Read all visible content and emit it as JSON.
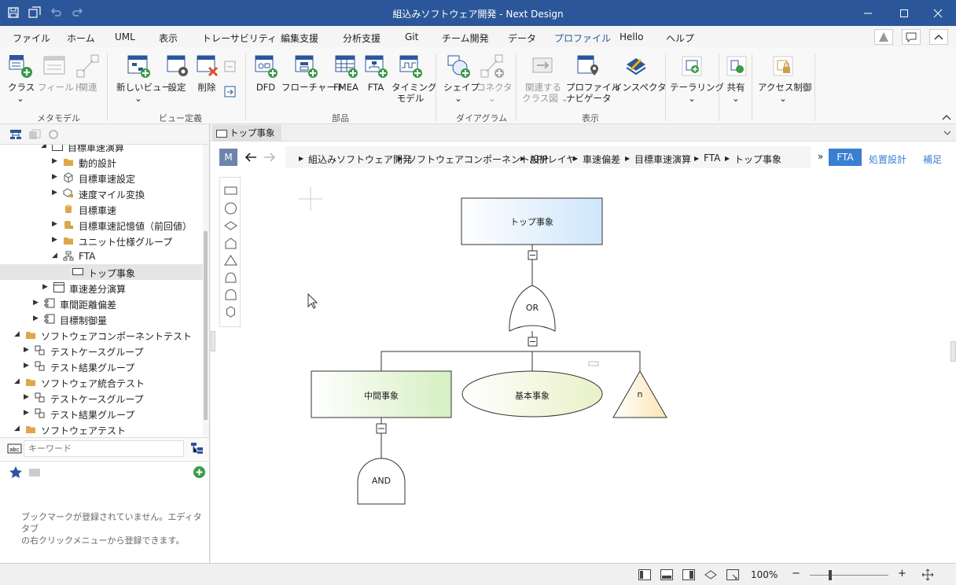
{
  "window": {
    "title": "組込みソフトウェア開発 - Next Design"
  },
  "menu": [
    "ファイル",
    "ホーム",
    "UML",
    "表示",
    "トレーサビリティ",
    "編集支援",
    "分析支援",
    "Git",
    "チーム開発",
    "データ",
    "プロファイル",
    "Hello",
    "ヘルプ"
  ],
  "ribbon": {
    "metamodel": {
      "group": "メタモデル",
      "class": "クラス",
      "field": "フィールド",
      "relation": "関連"
    },
    "viewdef": {
      "group": "ビュー定義",
      "new_view": "新しいビュー",
      "settings": "設定",
      "delete": "削除"
    },
    "parts": {
      "group": "部品",
      "dfd": "DFD",
      "flowchart": "フローチャート",
      "fmea": "FMEA",
      "fta": "FTA",
      "timing_1": "タイミング",
      "timing_2": "モデル"
    },
    "diagram": {
      "group": "ダイアグラム",
      "shape": "シェイプ",
      "connector": "コネクタ"
    },
    "display": {
      "group": "表示",
      "related_1": "関連する",
      "related_2": "クラス図",
      "profile_nav_1": "プロファイル",
      "profile_nav_2": "ナビゲータ",
      "inspector": "インスペクタ"
    },
    "tailoring": "テーラリング",
    "share": "共有",
    "access": "アクセス制御"
  },
  "tree": [
    {
      "label": "目標車速演算",
      "indent": 66,
      "icon": "model",
      "tri": "down"
    },
    {
      "label": "動的設計",
      "indent": 80,
      "icon": "folder",
      "tri": "right"
    },
    {
      "label": "目標車速設定",
      "indent": 80,
      "icon": "cube",
      "tri": "right"
    },
    {
      "label": "速度マイル変換",
      "indent": 80,
      "icon": "cube-lock",
      "tri": "right"
    },
    {
      "label": "目標車速",
      "indent": 80,
      "icon": "cylinder",
      "tri": ""
    },
    {
      "label": "目標車速記憶値（前回値）",
      "indent": 80,
      "icon": "cylinder-lock",
      "tri": "right"
    },
    {
      "label": "ユニット仕様グループ",
      "indent": 80,
      "icon": "folder",
      "tri": "right"
    },
    {
      "label": "FTA",
      "indent": 80,
      "icon": "fta",
      "tri": "down"
    },
    {
      "label": "トップ事象",
      "indent": 92,
      "icon": "rect",
      "tri": ""
    },
    {
      "label": "車速差分演算",
      "indent": 68,
      "icon": "model",
      "tri": "right"
    },
    {
      "label": "車間距離偏差",
      "indent": 56,
      "icon": "component",
      "tri": "right"
    },
    {
      "label": "目標制御量",
      "indent": 56,
      "icon": "component",
      "tri": "right"
    },
    {
      "label": "ソフトウェアコンポーネントテスト",
      "indent": 32,
      "icon": "folder",
      "tri": "down"
    },
    {
      "label": "テストケースグループ",
      "indent": 44,
      "icon": "group",
      "tri": "right"
    },
    {
      "label": "テスト結果グループ",
      "indent": 44,
      "icon": "group",
      "tri": "right"
    },
    {
      "label": "ソフトウェア統合テスト",
      "indent": 32,
      "icon": "folder",
      "tri": "down"
    },
    {
      "label": "テストケースグループ",
      "indent": 44,
      "icon": "group",
      "tri": "right"
    },
    {
      "label": "テスト結果グループ",
      "indent": 44,
      "icon": "group",
      "tri": "right"
    },
    {
      "label": "ソフトウェアテスト",
      "indent": 32,
      "icon": "folder",
      "tri": "down"
    }
  ],
  "search": {
    "placeholder": "キーワード"
  },
  "bookmark": {
    "empty_1": "ブックマークが登録されていません。エディタタブ",
    "empty_2": "の右クリックメニューから登録できます。"
  },
  "editor": {
    "tab": "トップ事象",
    "mode": "M",
    "breadcrumb": [
      "組込みソフトウェア開発",
      "ソフトウェアコンポーネント設計",
      "APPレイヤ",
      "車速偏差",
      "目標車速演算",
      "FTA",
      "トップ事象"
    ],
    "views": {
      "fta": "FTA",
      "placement": "処置設計",
      "supplement": "補足"
    }
  },
  "diagram": {
    "top": "トップ事象",
    "or_gate": "OR",
    "intermediate": "中間事象",
    "basic": "基本事象",
    "transfer": "n",
    "and_gate": "AND"
  },
  "status": {
    "zoom": "100%"
  }
}
